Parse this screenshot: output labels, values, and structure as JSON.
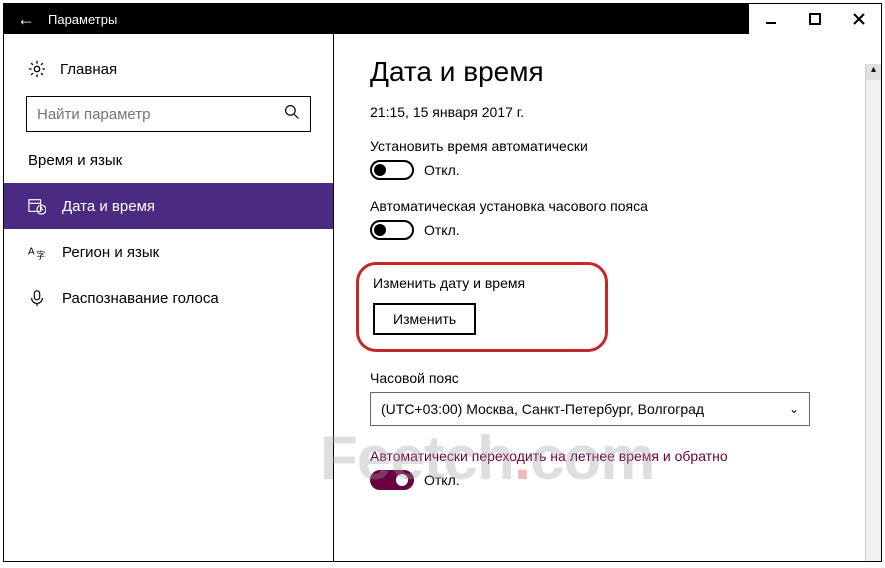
{
  "titlebar": {
    "back": "←",
    "title": "Параметры"
  },
  "sidebar": {
    "home": "Главная",
    "search_placeholder": "Найти параметр",
    "category": "Время и язык",
    "items": [
      {
        "label": "Дата и время"
      },
      {
        "label": "Регион и язык"
      },
      {
        "label": "Распознавание голоса"
      }
    ]
  },
  "content": {
    "title": "Дата и время",
    "datetime": "21:15, 15 января 2017 г.",
    "auto_time_label": "Установить время автоматически",
    "auto_time_state": "Откл.",
    "auto_tz_label": "Автоматическая установка часового пояса",
    "auto_tz_state": "Откл.",
    "change_section": "Изменить дату и время",
    "change_button": "Изменить",
    "tz_label": "Часовой пояс",
    "tz_value": "(UTC+03:00) Москва, Санкт-Петербург, Волгоград",
    "dst_label": "Автоматически переходить на летнее время и обратно",
    "dst_state": "Откл."
  },
  "watermark": {
    "a": "Feetch",
    "b": ".",
    "c": "com"
  }
}
